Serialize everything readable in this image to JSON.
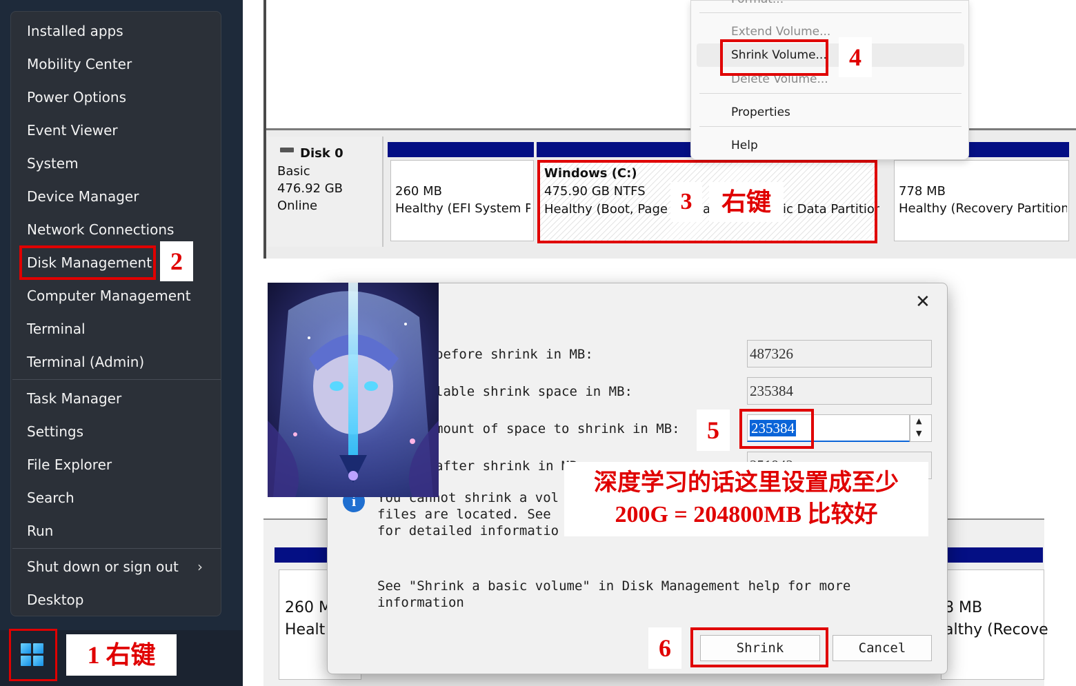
{
  "winx_menu": {
    "items": [
      "Installed apps",
      "Mobility Center",
      "Power Options",
      "Event Viewer",
      "System",
      "Device Manager",
      "Network Connections",
      "Disk Management",
      "Computer Management",
      "Terminal",
      "Terminal (Admin)",
      "Task Manager",
      "Settings",
      "File Explorer",
      "Search",
      "Run",
      "Shut down or sign out",
      "Desktop"
    ]
  },
  "annotations": {
    "step1": "1 右键",
    "step2": "2",
    "step3_num": "3",
    "step3_text": "右键",
    "step4": "4",
    "step5": "5",
    "step6": "6",
    "note_line1": "深度学习的话这里设置成至少",
    "note_line2": "200G = 204800MB 比较好"
  },
  "context_menu": {
    "format": "Format...",
    "extend": "Extend Volume...",
    "shrink": "Shrink Volume...",
    "delete": "Delete Volume...",
    "properties": "Properties",
    "help": "Help"
  },
  "disk_top": {
    "name": "Disk 0",
    "type": "Basic",
    "size": "476.92 GB",
    "status": "Online",
    "p1_size": "260 MB",
    "p1_status": "Healthy (EFI System Partition)",
    "p2_name": "Windows   (C:)",
    "p2_size": "475.90 GB NTFS",
    "p2_status_a": "Healthy (Boot, Page Fi",
    "p2_status_b": "a",
    "p2_status_c": "ic Data Partition)",
    "p3_size": "778 MB",
    "p3_status": "Healthy (Recovery Partition)"
  },
  "dialog": {
    "close_glyph": "✕",
    "label_total": "before shrink in MB:",
    "label_avail": "lable shrink space in MB:",
    "label_amount": "mount of space to shrink in MB:",
    "label_after": "after shrink in MB:",
    "val_total": "487326",
    "val_avail": "235384",
    "val_amount": "235384",
    "val_after": "251942",
    "info_line1": "You cannot shrink a vol",
    "info_line2": "files are located. See",
    "info_line3": "for detailed informatio",
    "help_line1": "See \"Shrink a basic volume\" in Disk Management help for more",
    "help_line2": "information",
    "shrink_btn": "Shrink",
    "cancel_btn": "Cancel"
  },
  "disk_bottom": {
    "p1_size": "260 M",
    "p1_status": "Healt",
    "p3_size": "8 MB",
    "p3_status": "althy (Recove"
  },
  "colors": {
    "annotation_red": "#e00000",
    "partition_bar": "#040f84",
    "menu_bg": "#2b3038",
    "selection_blue": "#0a64d8"
  }
}
